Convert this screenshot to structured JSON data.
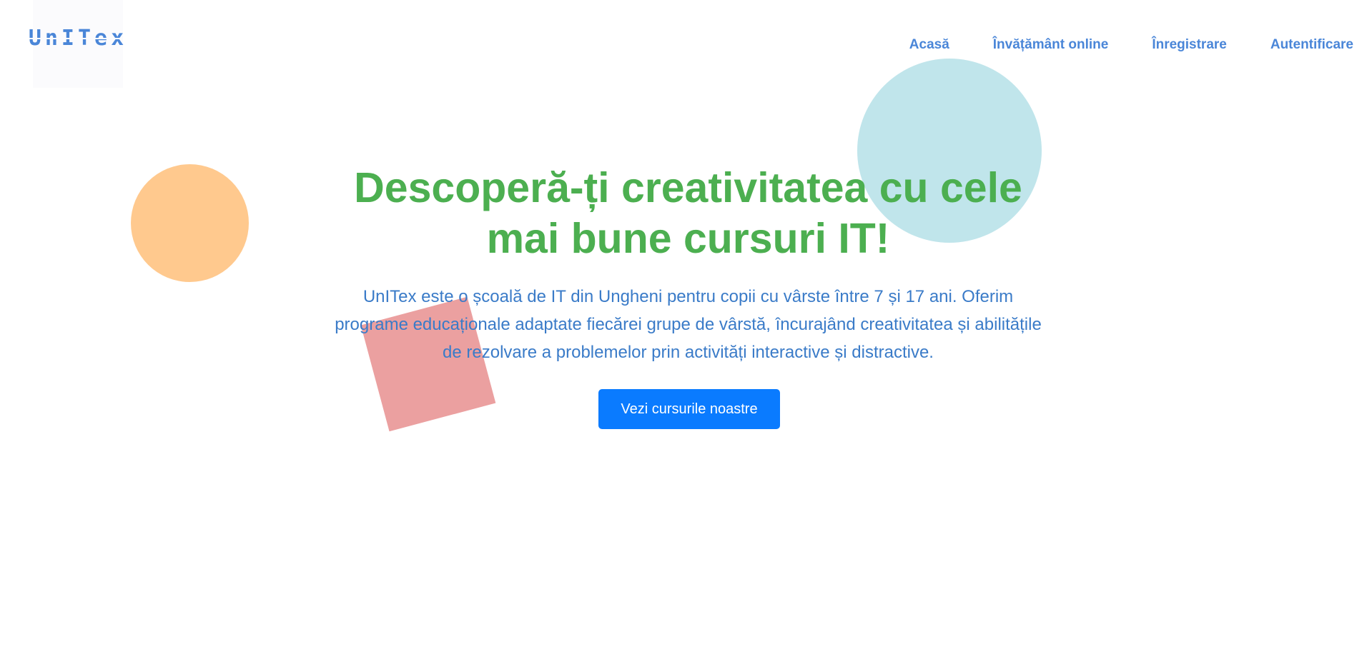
{
  "brand": {
    "logo_text": "UnITex"
  },
  "nav": {
    "items": [
      {
        "label": "Acasă"
      },
      {
        "label": "Învățământ online"
      },
      {
        "label": "Înregistrare"
      },
      {
        "label": "Autentificare"
      }
    ]
  },
  "hero": {
    "title": "Descoperă-ți creativitatea cu cele mai bune cursuri IT!",
    "description": "UnITex este o școală de IT din Ungheni pentru copii cu vârste între 7 și 17 ani. Oferim programe educaționale adaptate fiecărei grupe de vârstă, încurajând creativitatea și abilitățile de rezolvare a problemelor prin activități interactive și distractive.",
    "cta_label": "Vezi cursurile noastre"
  },
  "colors": {
    "accent": "#4a86d8",
    "title_green": "#4caf50",
    "button_blue": "#0a7bff",
    "shape_orange": "#ffc98e",
    "shape_blue": "#c0e5eb",
    "shape_red": "#eba0a0"
  }
}
